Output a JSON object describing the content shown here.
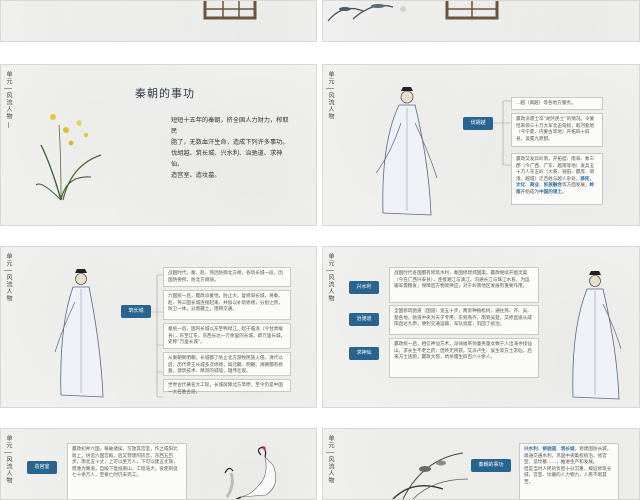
{
  "sidebar": {
    "unit_label": "单元",
    "theme_label": "风流人物"
  },
  "slide_qin": {
    "title": "秦朝的事功",
    "paragraph": [
      "短短十五年的秦朝，挤全国人力财力，榨取民",
      "脂了，无数血汗生命，造成下列许多事功。",
      "伐胡越、筑长城、兴水利、治驰道、求神仙、",
      "造宫室、造坟墓。"
    ]
  },
  "slide_fahuyue": {
    "tag": "伐胡越",
    "box1": "...越（闽越）等各地方服务。",
    "box2_parts": [
      "嬴政派遣士卒",
      "“胡凭民士”的情况。令蒙恬率领三十万大军北击匈奴，取河套地（今宁夏、内蒙古等地）开拓四十四县，设置九原郡。"
    ],
    "box3_parts": [
      "嬴政又发兵岭南，开拓桂、南海、象三郡（今广西、广东、越南等地）发兵五十万人守五岭（大庾、骑田、都庞、萌渚、越城）迁百姓与越人杂处，",
      "移民",
      "，",
      "文化",
      "、",
      "商业",
      "、",
      "民族融合",
      "等方面发展，",
      "岭南",
      "开始成为",
      "中国的领土",
      "。"
    ]
  },
  "slide_changcheng": {
    "tag": "筑长城",
    "box1": "战国时代，秦、赵、燕因防御北方胡，各筑长城一段，因国防要所。防北方胡骑。",
    "box2": "六国统一后，嬴政派蒙恬，防止大，复修旧长城，将秦、赵、燕三国长城连接起来，并加以补筑修缮，分别之所，防卫一体，分割疆土，阻碍交通。",
    "box3": "秦统一后，国内长城以东至鸭绿江，起于临洮（今甘肃岷县），东至辽东，东西长达一万余里的长城，即万里长城，史称“万里长城”。",
    "box4": "从秦朝到明朝，长城都了防止北方游牧民族入侵。清代以后，历代帝王长城多次修缮，如元朝、明朝、清朝都有修葺，建筑技术、精湛的城墙，雄伟壮观。",
    "box5": "世界古代著名大工程，长城屏障北方草原，至今仍是中国一大名胜古迹。"
  },
  "slide_water": {
    "tags": [
      "兴水利",
      "治驰道",
      "求神仙"
    ],
    "box1": "战国时代各国都有修筑水利，秦国修建郑国渠。嬴政继续开凿灵渠（今在广西兴安县），连接湘江与漓江，沟通长江与珠江水系，为运输军需粮食，保障后方物资供应，对于岭南地区发展有重要作用。",
    "box2": "全国修筑驰道（国道）宽五十步，两旁种植松树，通往燕、齐、吴、楚各地，驰道中央为天子专用，东到燕齐，南到吴楚，又修直道从咸阳直达九原，便利交通运输，军队调度，巩固了统治。",
    "box3": "嬴政统一后，相信神仙方术，派徐福带领童男童女数千人出海寻找仙山，求长生不老之药，但终无所获。又派卢生、侯生等方士求仙，后来方士逃跑，嬴政大怒，坑杀儒生四百六十余人。"
  },
  "slide_palace": {
    "tag": "造宫室",
    "box": "嬴政初并六国，每破诸侯，写放其宫室，作之咸阳北坂上，仿造六国宫殿。后又营建阿房宫，东西五百步，南北五十丈，上可以坐万人，下可以建五丈旗，周驰为阁道，自殿下直抵南山。工程浩大，役使刑徒七十余万人，至秦亡时仍未完工。"
  },
  "slide_summary": {
    "tag": "秦朝的事功",
    "box_parts": [
      "兴水利",
      "、",
      "修驰道",
      "、",
      "筑长城",
      "，修建国防长城，疏通交通水利，巩固中央集权统治，修宫室、造坟墓……，推进生产和发展。",
      "但是当时人民的负担十分沉重，被迫修筑长城、宫室、坟墓的人力物力，人民不堪其苦。"
    ]
  },
  "colors": {
    "accent": "#27648f",
    "highlight": "#2a6ea0",
    "background": "#f1f1ef"
  }
}
